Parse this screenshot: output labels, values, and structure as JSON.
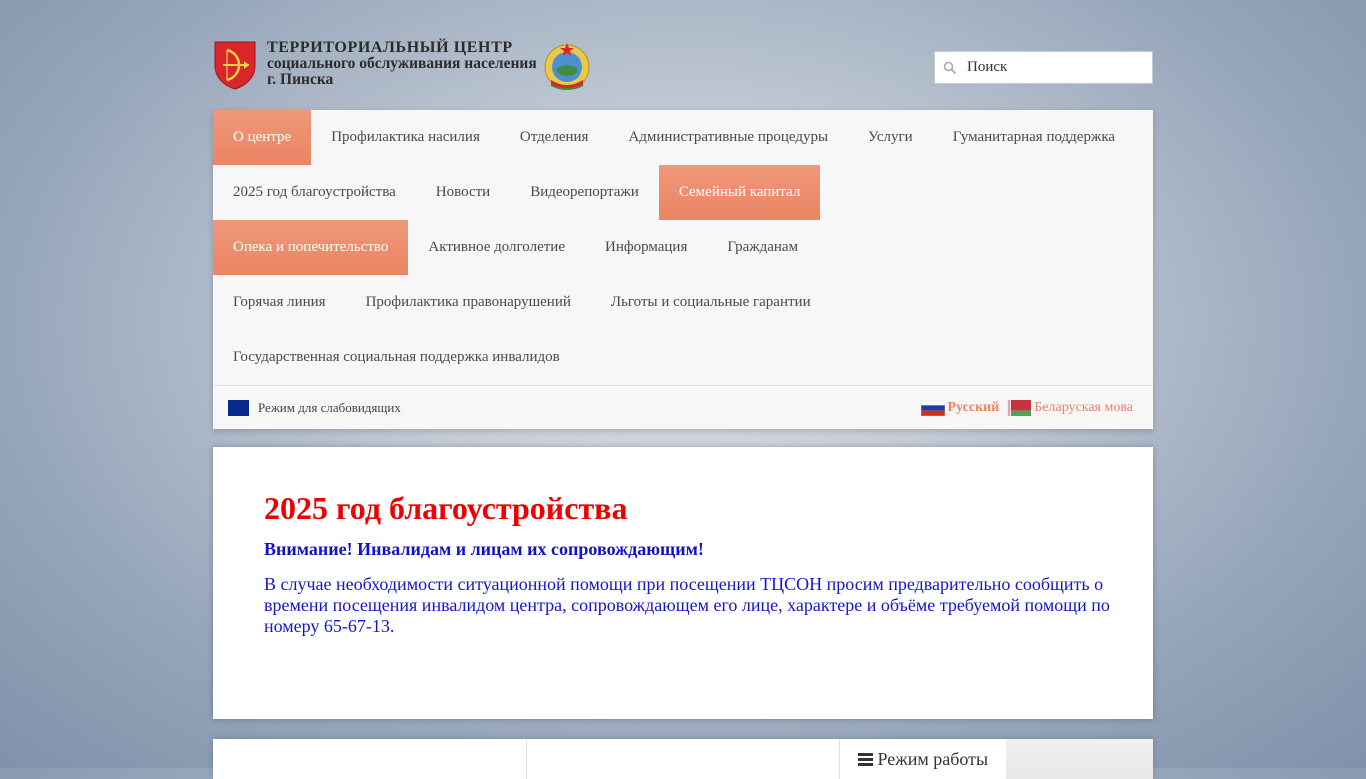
{
  "header": {
    "logo_line1": "ТЕРРИТОРИАЛЬНЫЙ  ЦЕНТР",
    "logo_line2": "социального обслуживания населения",
    "logo_line3": "г. Пинска",
    "search_placeholder": "Поиск"
  },
  "nav": {
    "rows": [
      [
        {
          "label": "О центре",
          "active": true
        },
        {
          "label": "Профилактика насилия",
          "active": false
        },
        {
          "label": "Отделения",
          "active": false
        },
        {
          "label": "Административные процедуры",
          "active": false
        },
        {
          "label": "Услуги",
          "active": false
        },
        {
          "label": "Гуманитарная поддержка",
          "active": false
        }
      ],
      [
        {
          "label": "2025 год благоустройства",
          "active": false
        },
        {
          "label": "Новости",
          "active": false
        },
        {
          "label": "Видеорепортажи",
          "active": false
        },
        {
          "label": "Семейный капитал",
          "active": true
        }
      ],
      [
        {
          "label": "Опека и попечительство",
          "active": true
        },
        {
          "label": "Активное долголетие",
          "active": false
        },
        {
          "label": "Информация",
          "active": false
        },
        {
          "label": "Гражданам",
          "active": false
        }
      ],
      [
        {
          "label": "Горячая линия",
          "active": false
        },
        {
          "label": "Профилактика правонарушений",
          "active": false
        },
        {
          "label": "Льготы и социальные гарантии",
          "active": false
        }
      ],
      [
        {
          "label": "Государственная социальная поддержка инвалидов",
          "active": false
        }
      ]
    ],
    "low_vision_label": "Режим для слабовидящих",
    "lang_ru": "Русский",
    "lang_by": "Беларуская мова"
  },
  "content": {
    "title": "2025 год благоустройства",
    "notice": "Внимание! Инвалидам и лицам их сопровождающим!",
    "paragraph": "В случае необходимости ситуационной помощи при посещении ТЦСОН просим предварительно сообщить о времени посещения инвалидом центра, сопровождающем его лице, характере и объёме требуемой помощи по номеру 65-67-13."
  },
  "bottom": {
    "tab_label": "Режим работы"
  },
  "colors": {
    "accent": "#e98563",
    "title_red": "#ee0000",
    "text_blue": "#1515d0"
  },
  "icons": [
    "coat-of-arms-pinsk-icon",
    "belarus-emblem-icon",
    "search-icon",
    "low-vision-icon",
    "flag-ru-icon",
    "flag-by-icon",
    "menu-bars-icon"
  ]
}
